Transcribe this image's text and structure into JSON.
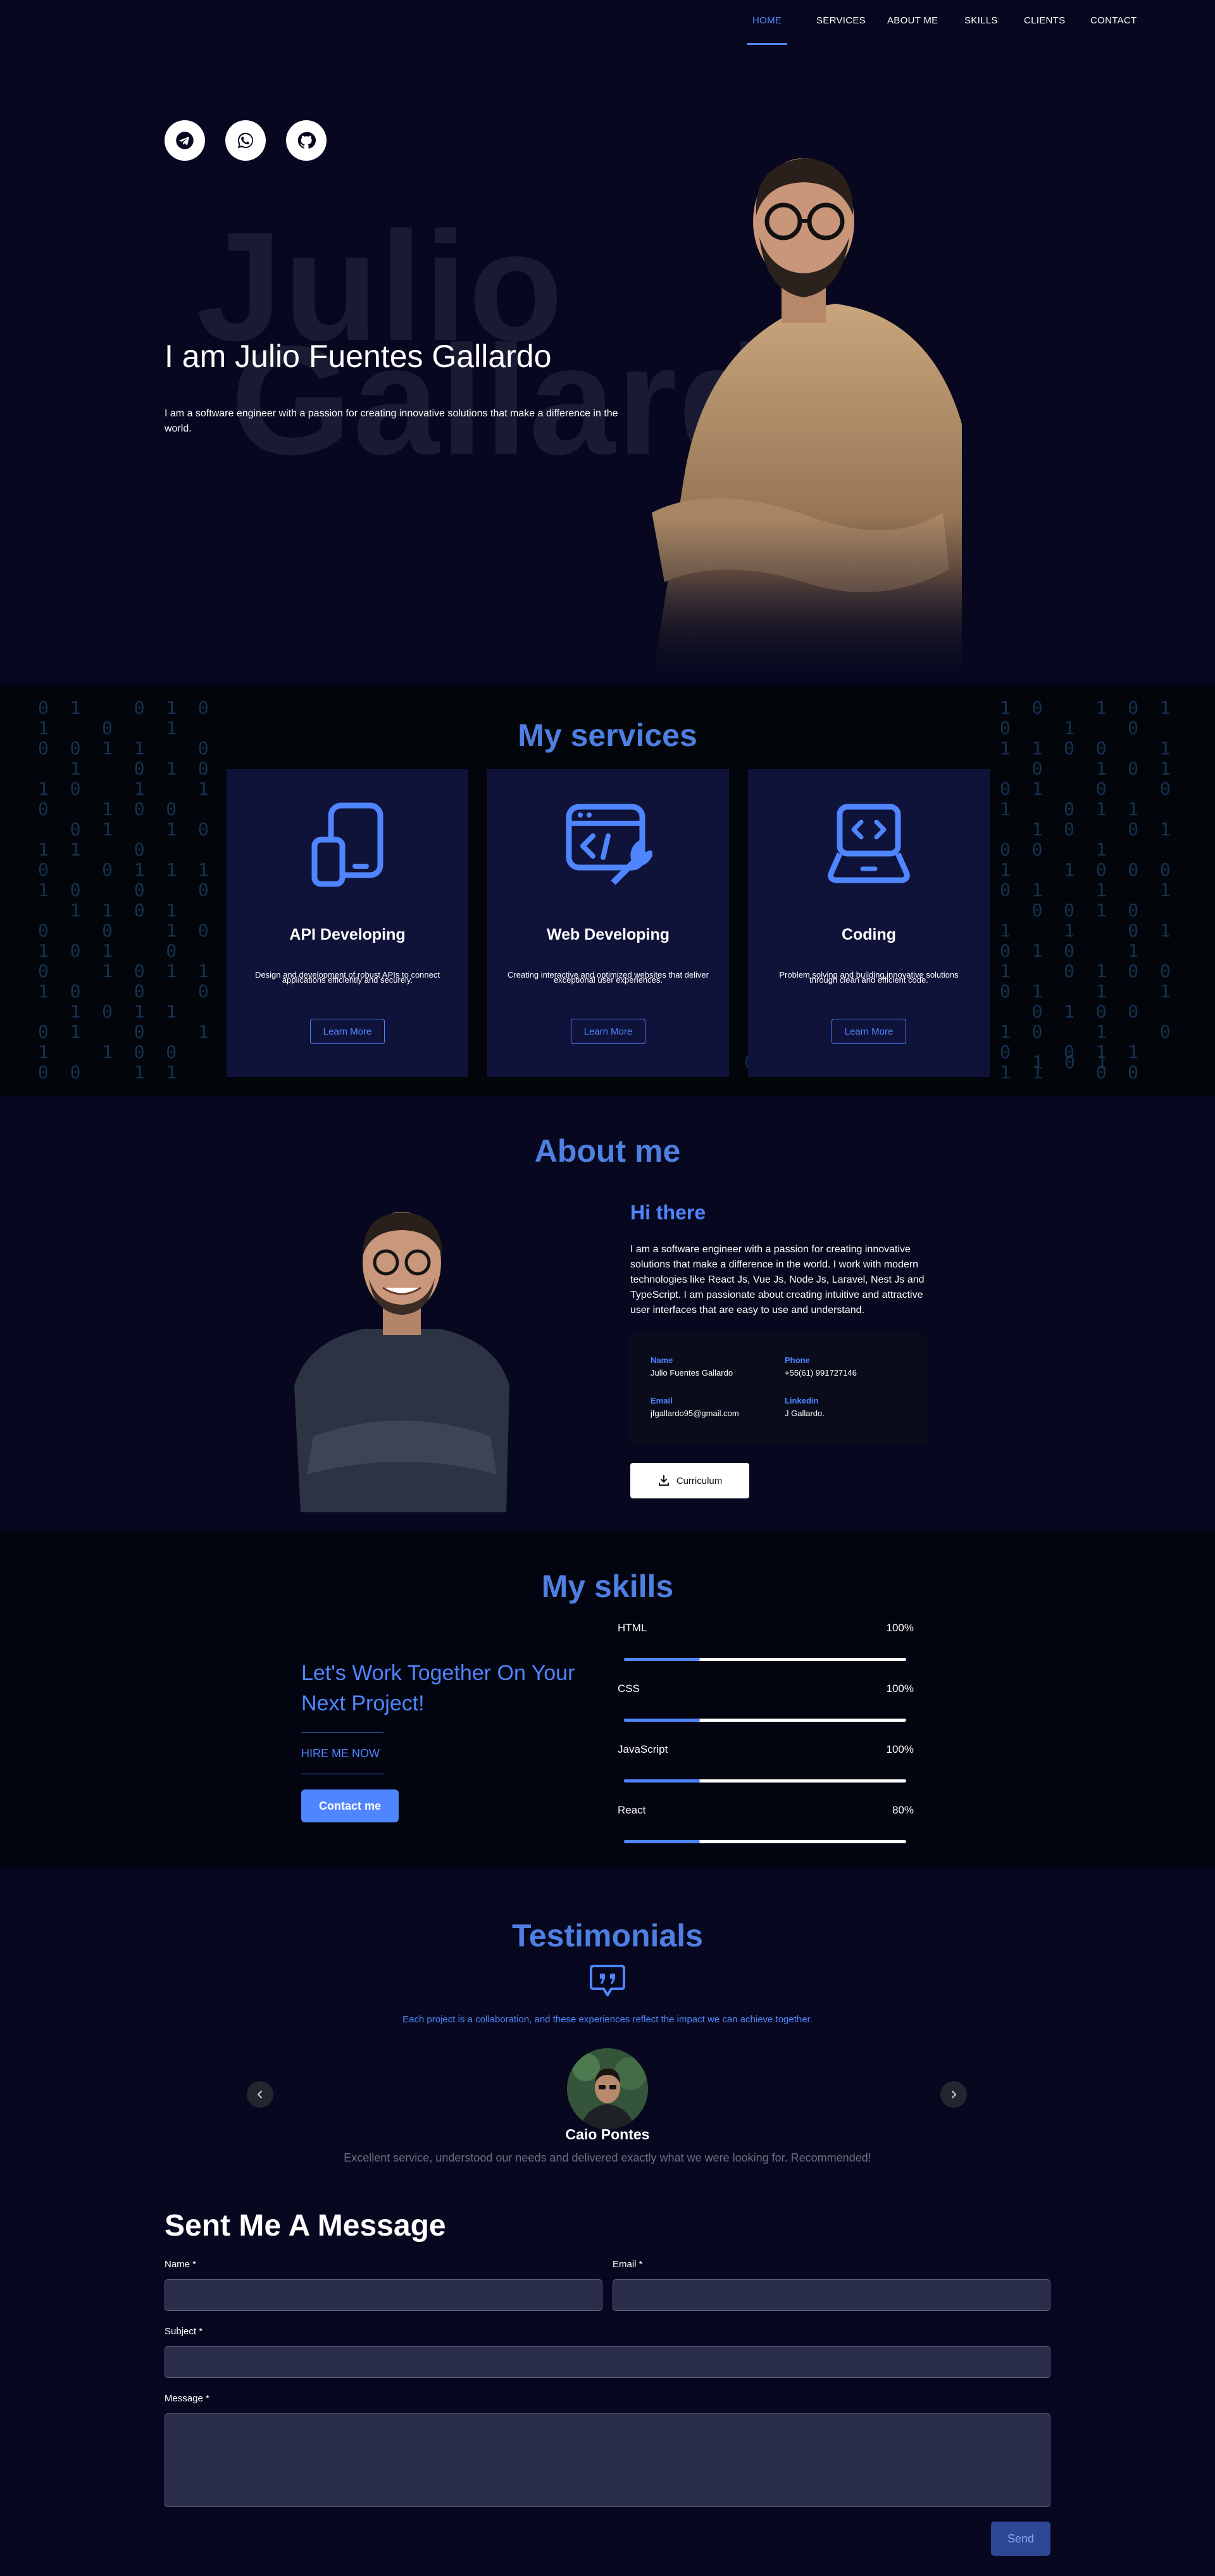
{
  "nav": {
    "items": [
      "HOME",
      "SERVICES",
      "ABOUT ME",
      "SKILLS",
      "CLIENTS",
      "CONTACT"
    ],
    "active": "HOME"
  },
  "hero": {
    "social_icons": [
      "telegram-icon",
      "whatsapp-icon",
      "github-icon"
    ],
    "bg_words": [
      "Julio",
      "Gallardo"
    ],
    "title": "I am Julio Fuentes Gallardo",
    "description": "I am a software engineer with a passion for creating innovative solutions that make a difference in the world."
  },
  "services": {
    "title": "My services",
    "cards": [
      {
        "icon": "devices-icon",
        "title": "API Developing",
        "description": "Design and development of robust APIs to connect applications efficiently and securely.",
        "button": "Learn More"
      },
      {
        "icon": "web-settings-icon",
        "title": "Web Developing",
        "description": "Creating interactive and optimized websites that deliver exceptional user experiences.",
        "button": "Learn More"
      },
      {
        "icon": "laptop-code-icon",
        "title": "Coding",
        "description": "Problem solving and building innovative solutions through clean and efficient code.",
        "button": "Learn More"
      }
    ]
  },
  "about": {
    "title": "About me",
    "heading": "Hi there",
    "text": "I am a software engineer with a passion for creating innovative solutions that make a difference in the world. I work with modern technologies like React Js, Vue Js, Node Js, Laravel, Nest Js and TypeScript. I am passionate about creating intuitive and attractive user interfaces that are easy to use and understand.",
    "info": {
      "name_label": "Name",
      "name": "Julio Fuentes Gallardo",
      "phone_label": "Phone",
      "phone": "+55(61) 991727146",
      "email_label": "Email",
      "email": "jfgallardo95@gmail.com",
      "linkedin_label": "Linkedin",
      "linkedin": "J Gallardo."
    },
    "cv_button": "Curriculum"
  },
  "skills": {
    "title": "My skills",
    "cta": "Let's Work Together On Your Next Project!",
    "hire": "HIRE ME NOW",
    "contact_button": "Contact me",
    "items": [
      {
        "name": "HTML",
        "percent": "100%"
      },
      {
        "name": "CSS",
        "percent": "100%"
      },
      {
        "name": "JavaScript",
        "percent": "100%"
      },
      {
        "name": "React",
        "percent": "80%"
      }
    ]
  },
  "testimonials": {
    "title": "Testimonials",
    "subtitle": "Each project is a collaboration, and these experiences reflect the impact we can achieve together.",
    "name": "Caio Pontes",
    "text": "Excellent service, understood our needs and delivered exactly what we were looking for. Recommended!"
  },
  "contact_form": {
    "title": "Sent Me A Message",
    "name_label": "Name *",
    "email_label": "Email *",
    "subject_label": "Subject *",
    "message_label": "Message *",
    "send": "Send"
  },
  "colors": {
    "accent": "#4f85ff",
    "background": "#07081f",
    "card": "#0f1339"
  }
}
